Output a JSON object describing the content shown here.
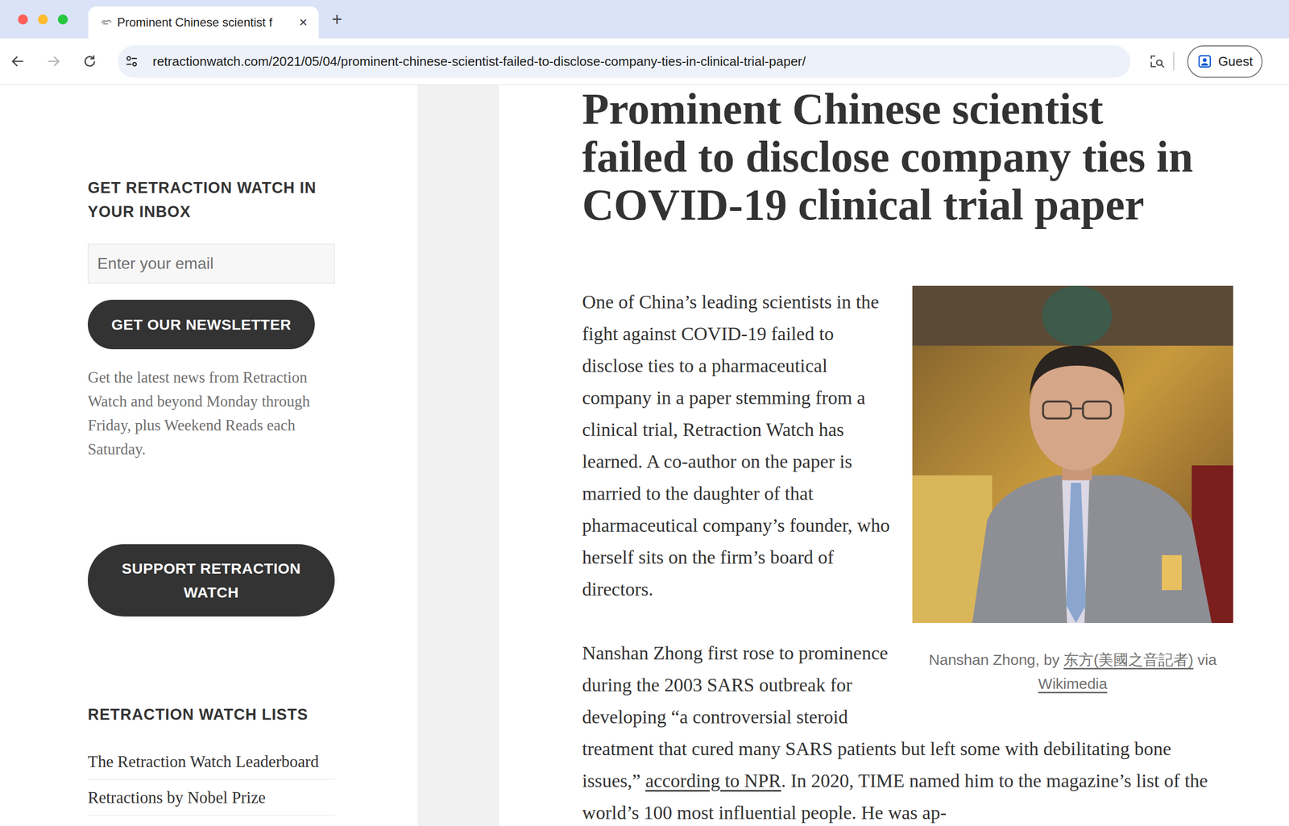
{
  "browser": {
    "tab": {
      "title": "Prominent Chinese scientist f",
      "close": "×",
      "selected": true
    },
    "new_tab": "+",
    "forward_disabled": true,
    "url": "retractionwatch.com/2021/05/04/prominent-chinese-scientist-failed-to-disclose-company-ties-in-clinical-trial-paper/",
    "profile": "Guest"
  },
  "sidebar": {
    "newsletter": {
      "heading": "GET RETRACTION WATCH IN YOUR INBOX",
      "placeholder": "Enter your email",
      "button": "GET OUR NEWSLETTER",
      "description": "Get the latest news from Retraction Watch and beyond Monday through Friday, plus Weekend Reads each Saturday."
    },
    "support_button": "SUPPORT RETRACTION WATCH",
    "lists": {
      "heading": "RETRACTION WATCH LISTS",
      "items": [
        "The Retraction Watch Leaderboard",
        "Retractions by Nobel Prize"
      ]
    }
  },
  "article": {
    "title_lines": [
      "Prominent Chinese scientist",
      "failed to disclose company ties in",
      "COVID-19 clinical trial paper"
    ],
    "figure": {
      "caption": [
        {
          "text": "Nanshan Zhong, by ",
          "link": false
        },
        {
          "text": "东方(美國之音記者)",
          "link": true
        },
        {
          "text": " via ",
          "link": false
        },
        {
          "text": "Wikimedia",
          "link": true
        }
      ]
    },
    "paragraphs": [
      [
        {
          "text": "One of China’s leading scientists in the fight against COVID-19 failed to disclose ties to a pharmaceutical company in a paper stemming from a clinical trial, Retraction Watch has learned. A co-author on the paper is married to the daughter of that pharmaceutical company’s founder, who herself sits on the firm’s board of directors.",
          "link": false
        }
      ],
      [
        {
          "text": "Nanshan Zhong first rose to prominence during the 2003 SARS outbreak for developing “a controversial steroid treatment that cured many SARS patients but left some with debilitating bone issues,” ",
          "link": false
        },
        {
          "text": "according to NPR",
          "link": true
        },
        {
          "text": ". In 2020, TIME named him to the magazine’s list of the world’s 100 most influential people. He was ap-",
          "link": false
        }
      ]
    ]
  }
}
